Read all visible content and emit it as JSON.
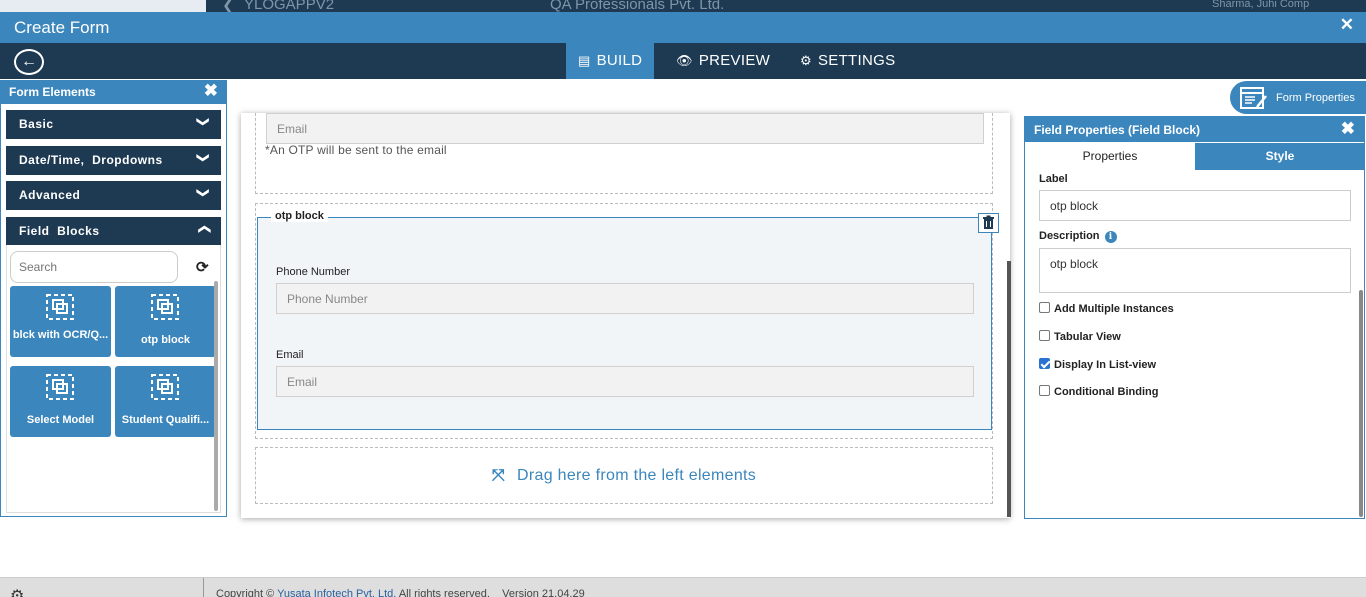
{
  "background_app": {
    "app_name": "YLOGAPPV2",
    "company": "QA Professionals Pvt. Ltd.",
    "user": "Sharma, Juhi Comp"
  },
  "modal": {
    "title": "Create Form"
  },
  "nav": {
    "tabs": [
      {
        "label": "BUILD",
        "icon": "build-icon",
        "active": true
      },
      {
        "label": "PREVIEW",
        "icon": "eye-icon",
        "active": false
      },
      {
        "label": "SETTINGS",
        "icon": "gear-icon",
        "active": false
      }
    ]
  },
  "left_panel": {
    "title": "Form Elements",
    "sections": [
      {
        "label": "Basic",
        "expanded": false
      },
      {
        "label": "Date/Time,  Dropdowns",
        "expanded": false
      },
      {
        "label": "Advanced",
        "expanded": false
      },
      {
        "label": "Field  Blocks",
        "expanded": true
      }
    ],
    "search_placeholder": "Search",
    "tiles": [
      {
        "label": "blck with OCR/Q..."
      },
      {
        "label": "otp block"
      },
      {
        "label": "Select Model"
      },
      {
        "label": "Student Qualifi..."
      }
    ]
  },
  "canvas": {
    "top_block": {
      "email_placeholder": "Email",
      "note": "*An OTP will be sent to the email"
    },
    "otp_block": {
      "legend": "otp block",
      "fields": [
        {
          "label": "Phone Number",
          "placeholder": "Phone Number"
        },
        {
          "label": "Email",
          "placeholder": "Email"
        }
      ]
    },
    "drop_zone_text": "Drag here from the left elements"
  },
  "form_properties_button": "Form Properties",
  "right_panel": {
    "title": "Field Properties (Field Block)",
    "tabs": [
      "Properties",
      "Style"
    ],
    "label_caption": "Label",
    "label_value": "otp block",
    "description_caption": "Description",
    "description_value": "otp block",
    "checkboxes": [
      {
        "label": "Add Multiple Instances",
        "checked": false
      },
      {
        "label": "Tabular View",
        "checked": false
      },
      {
        "label": "Display In List-view",
        "checked": true
      },
      {
        "label": "Conditional Binding",
        "checked": false
      }
    ]
  },
  "footer": {
    "copyright_prefix": "Copyright ©",
    "company_link": "Yusata Infotech Pvt. Ltd.",
    "rights": "All rights reserved.",
    "version_label": "Version",
    "version": "21.04.29"
  },
  "colors": {
    "primary": "#3b86bd",
    "dark": "#1d3a52"
  }
}
